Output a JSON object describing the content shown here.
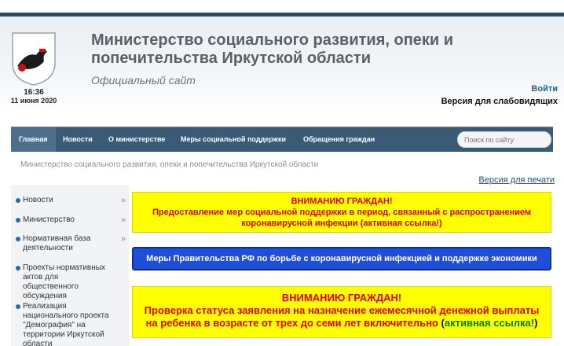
{
  "header": {
    "title": "Министерство социального развития, опеки и попечительства Иркутской области",
    "subtitle": "Официальный сайт",
    "time": "16:36",
    "date": "11 июня 2020",
    "login": "Войти",
    "low_vision": "Версия для слабовидящих"
  },
  "nav": {
    "items": [
      "Главная",
      "Новости",
      "О министерстве",
      "Меры социальной поддержки",
      "Обращения граждан"
    ],
    "active": "Главная",
    "search_placeholder": "Поиск по сайту"
  },
  "breadcrumb": "Министерство социального развития, опеки и попечительства Иркутской области",
  "print_version": "Версия для печати",
  "sidebar": {
    "items": [
      {
        "label": "Новости",
        "arrow": "»"
      },
      {
        "label": "Министерство",
        "arrow": "»"
      },
      {
        "label": "Нормативная база деятельности",
        "arrow": "»"
      },
      {
        "label": "Проекты нормативных актов для общественного обсуждения",
        "arrow": ""
      },
      {
        "label": "Реализация национального проекта \"Демография\" на территории Иркутской области",
        "arrow": ""
      }
    ]
  },
  "notices": {
    "n1_heading": "ВНИМАНИЮ ГРАЖДАН!",
    "n1_line1": "Предоставление мер социальной поддержки в период, связанный с распространением",
    "n1_line2": "коронавирусной инфекции (активная ссылка!)",
    "n2_text": "Меры Правительства РФ по борьбе с коронавирусной инфекцией и поддержке экономики",
    "n3_heading": "ВНИМАНИЮ ГРАЖДАН!",
    "n3_line1": "Проверка статуса заявления на назначение ежемесячной денежной выплаты",
    "n3_line2": "на ребенка в возрасте от трех до семи лет включительно",
    "n3_link": "активная ссылка!",
    "n3_open": "(",
    "n3_close": ")"
  },
  "colors": {
    "navbar": "#3a5a75",
    "notice_yellow": "#ffff00",
    "notice_red_text": "#e60000",
    "notice_blue": "#1f4fd6"
  }
}
